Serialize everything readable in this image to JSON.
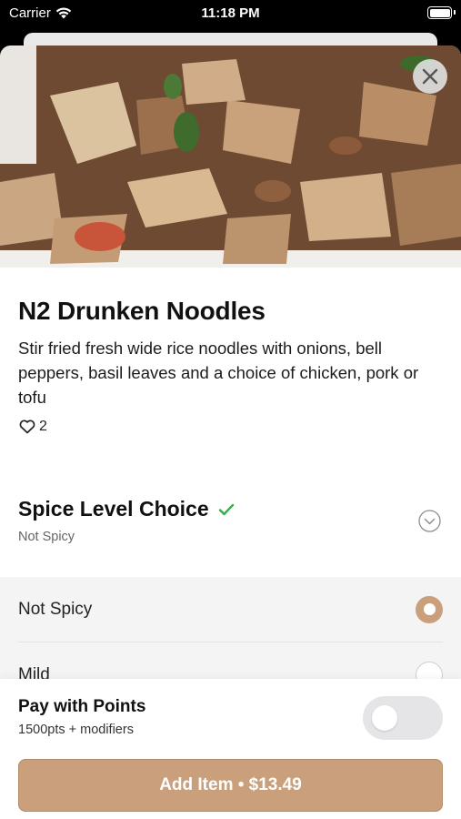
{
  "status_bar": {
    "carrier": "Carrier",
    "time": "11:18 PM"
  },
  "item": {
    "title": "N2 Drunken Noodles",
    "description": "Stir fried fresh wide rice noodles with onions, bell peppers, basil leaves and a choice of chicken, pork or tofu",
    "likes": "2"
  },
  "modifier": {
    "title": "Spice Level Choice",
    "selected": "Not Spicy",
    "options": [
      {
        "label": "Not Spicy",
        "selected": true
      },
      {
        "label": "Mild",
        "selected": false
      }
    ]
  },
  "footer": {
    "points_title": "Pay with Points",
    "points_sub": "1500pts + modifiers",
    "points_enabled": false,
    "add_button": "Add Item • $13.49"
  },
  "colors": {
    "accent": "#c9a07b",
    "check": "#2db34a"
  },
  "icons": [
    "wifi-icon",
    "battery-icon",
    "close-icon",
    "heart-icon",
    "check-icon",
    "chevron-down-icon"
  ]
}
